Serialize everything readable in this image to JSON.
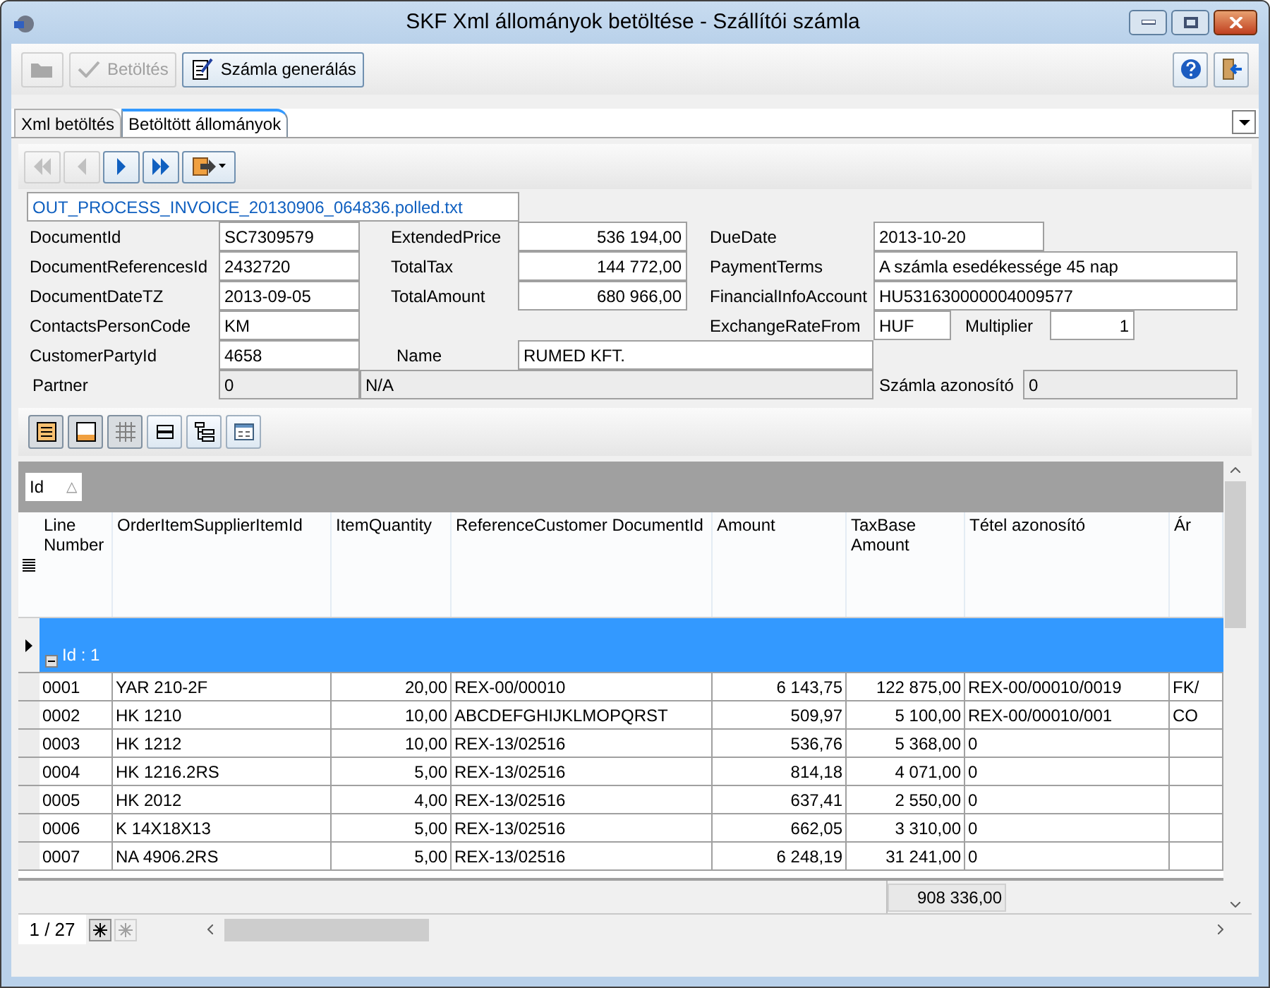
{
  "window": {
    "title": "SKF Xml állományok betöltése - Szállítói számla"
  },
  "toolbar": {
    "buttons": [
      {
        "kind": "open",
        "disabled": true
      },
      {
        "kind": "load",
        "label": "Betöltés",
        "disabled": true
      },
      {
        "kind": "generate",
        "label": "Számla generálás",
        "disabled": false
      }
    ],
    "right_buttons": [
      {
        "kind": "help"
      },
      {
        "kind": "exit"
      }
    ]
  },
  "tabs": [
    {
      "label": "Xml betöltés",
      "selected": false
    },
    {
      "label": "Betöltött állományok",
      "selected": true
    }
  ],
  "nav_buttons": [
    {
      "kind": "first",
      "disabled": true
    },
    {
      "kind": "prev",
      "disabled": true
    },
    {
      "kind": "next",
      "disabled": false
    },
    {
      "kind": "last",
      "disabled": false
    },
    {
      "kind": "export",
      "disabled": false
    }
  ],
  "form": {
    "file_name": "OUT_PROCESS_INVOICE_20130906_064836.polled.txt",
    "document_id": {
      "label": "DocumentId",
      "value": "SC7309579"
    },
    "document_references_id": {
      "label": "DocumentReferencesId",
      "value": "2432720"
    },
    "document_date": {
      "label": "DocumentDateTZ",
      "value": "2013-09-05"
    },
    "contacts_person_code": {
      "label": "ContactsPersonCode",
      "value": "KM"
    },
    "customer_party_id": {
      "label": "CustomerPartyId",
      "value": "4658"
    },
    "partner": {
      "label": "Partner",
      "code": "0",
      "name": "N/A"
    },
    "extended_price": {
      "label": "ExtendedPrice",
      "value": "536 194,00"
    },
    "total_tax": {
      "label": "TotalTax",
      "value": "144 772,00"
    },
    "total_amount": {
      "label": "TotalAmount",
      "value": "680 966,00"
    },
    "name": {
      "label": "Name",
      "value": "RUMED KFT."
    },
    "due_date": {
      "label": "DueDate",
      "value": "2013-10-20"
    },
    "payment_terms": {
      "label": "PaymentTerms",
      "value": "A számla esedékessége 45 nap"
    },
    "financial_info_account": {
      "label": "FinancialInfoAccount",
      "value": "HU531630000004009577"
    },
    "exchange_rate_from": {
      "label": "ExchangeRateFrom",
      "value": "HUF"
    },
    "multiplier": {
      "label": "Multiplier",
      "value": "1"
    },
    "invoice_id": {
      "label": "Számla azonosító",
      "value": "0"
    }
  },
  "view_buttons": [
    {
      "kind": "group-panel",
      "selected": true
    },
    {
      "kind": "footer",
      "selected": true
    },
    {
      "kind": "grid-lines",
      "selected": true
    },
    {
      "kind": "band",
      "selected": false
    },
    {
      "kind": "tree",
      "selected": false
    },
    {
      "kind": "card",
      "selected": false
    }
  ],
  "grid": {
    "group_by": {
      "label": "Id",
      "sort": "△"
    },
    "columns": [
      {
        "label": "Line Number"
      },
      {
        "label": "OrderItemSupplierItemId"
      },
      {
        "label": "ItemQuantity"
      },
      {
        "label": "ReferenceCustomer DocumentId"
      },
      {
        "label": "Amount"
      },
      {
        "label": "TaxBase Amount"
      },
      {
        "label": "Tétel azonosító"
      },
      {
        "label": "Ár"
      }
    ],
    "group": {
      "label": "Id : 1",
      "expanded": true
    },
    "rows": [
      {
        "cells": [
          "0001",
          "YAR 210-2F",
          "20,00",
          "REX-00/00010",
          "6 143,75",
          "122 875,00",
          "REX-00/00010/0019",
          "FK/"
        ]
      },
      {
        "cells": [
          "0002",
          "HK 1210",
          "10,00",
          "ABCDEFGHIJKLMOPQRST",
          "509,97",
          "5 100,00",
          "REX-00/00010/001",
          "CO"
        ]
      },
      {
        "cells": [
          "0003",
          "HK 1212",
          "10,00",
          "REX-13/02516",
          "536,76",
          "5 368,00",
          "0",
          ""
        ]
      },
      {
        "cells": [
          "0004",
          "HK 1216.2RS",
          "5,00",
          "REX-13/02516",
          "814,18",
          "4 071,00",
          "0",
          ""
        ]
      },
      {
        "cells": [
          "0005",
          "HK 2012",
          "4,00",
          "REX-13/02516",
          "637,41",
          "2 550,00",
          "0",
          ""
        ]
      },
      {
        "cells": [
          "0006",
          "K 14X18X13",
          "5,00",
          "REX-13/02516",
          "662,05",
          "3 310,00",
          "0",
          ""
        ]
      },
      {
        "cells": [
          "0007",
          "NA 4906.2RS",
          "5,00",
          "REX-13/02516",
          "6 248,19",
          "31 241,00",
          "0",
          ""
        ]
      }
    ],
    "summary": {
      "tax_base_total": "908 336,00"
    },
    "footer": {
      "position": "1 / 27"
    }
  }
}
